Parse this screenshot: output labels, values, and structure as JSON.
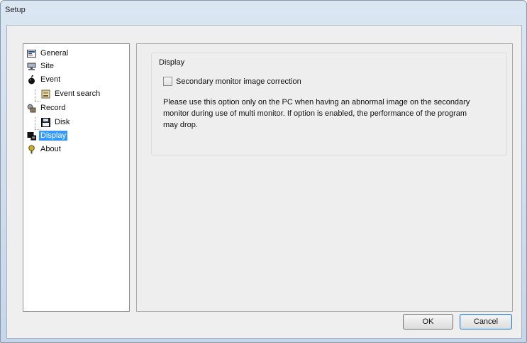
{
  "window": {
    "title": "Setup"
  },
  "tree": {
    "items": [
      {
        "label": "General",
        "icon": "general-icon"
      },
      {
        "label": "Site",
        "icon": "site-icon"
      },
      {
        "label": "Event",
        "icon": "event-icon"
      },
      {
        "label": "Event search",
        "icon": "event-search-icon"
      },
      {
        "label": "Record",
        "icon": "record-icon"
      },
      {
        "label": "Disk",
        "icon": "disk-icon"
      },
      {
        "label": "Display",
        "icon": "display-icon",
        "selected": true
      },
      {
        "label": "About",
        "icon": "about-icon"
      }
    ]
  },
  "panel": {
    "group_title": "Display",
    "checkbox_label": "Secondary monitor image correction",
    "checkbox_checked": false,
    "description": "Please use this option only on the PC when having an abnormal image on the secondary monitor during use of multi monitor. If option is enabled, the performance of the program may drop."
  },
  "buttons": {
    "ok": "OK",
    "cancel": "Cancel"
  }
}
